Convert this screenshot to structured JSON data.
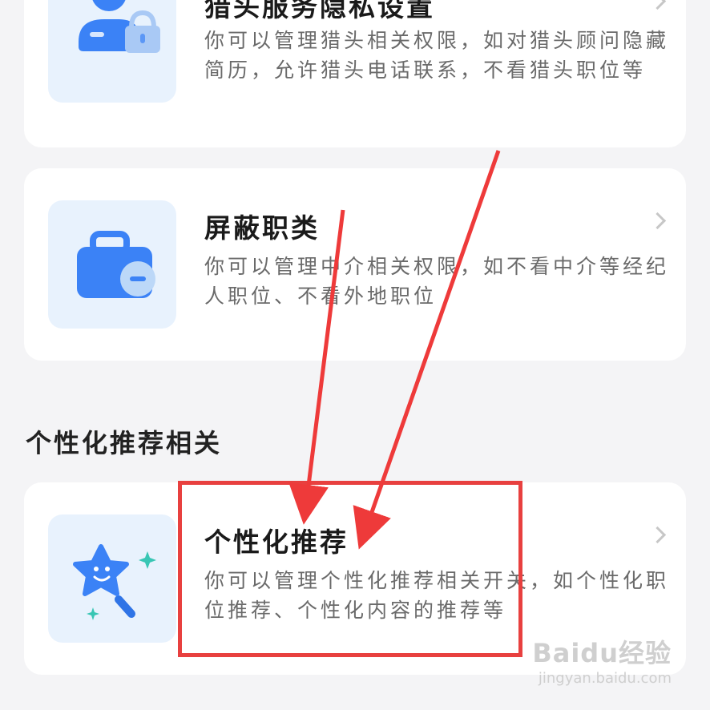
{
  "cards": [
    {
      "title": "猎头服务隐私设置",
      "desc": "你可以管理猎头相关权限，如对猎头顾问隐藏简历，允许猎头电话联系，不看猎头职位等",
      "icon": "user-lock-icon"
    },
    {
      "title": "屏蔽职类",
      "desc": "你可以管理中介相关权限，如不看中介等经纪人职位、不看外地职位",
      "icon": "briefcase-minus-icon"
    },
    {
      "title": "个性化推荐",
      "desc": "你可以管理个性化推荐相关开关，如个性化职位推荐、个性化内容的推荐等",
      "icon": "star-wand-icon"
    }
  ],
  "section": {
    "title": "个性化推荐相关"
  },
  "watermark": {
    "logo": "Baidu经验",
    "url": "jingyan.baidu.com"
  },
  "colors": {
    "accent": "#3b82f6",
    "highlight": "#e8403f",
    "background": "#f4f4f6"
  }
}
